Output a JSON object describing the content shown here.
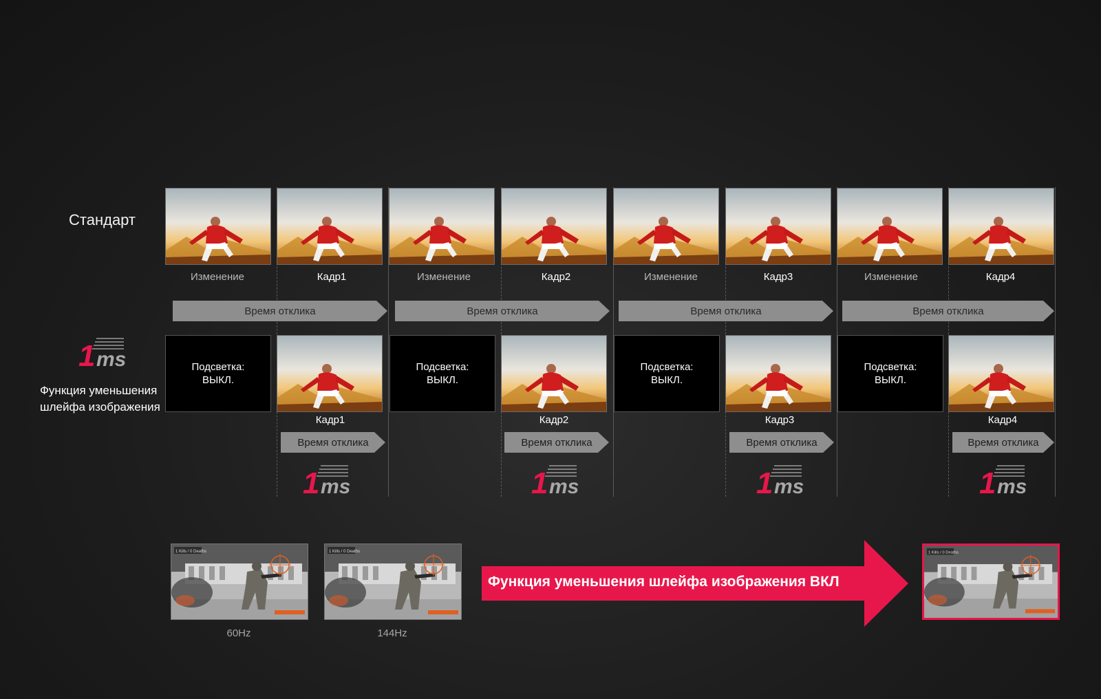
{
  "colors": {
    "accent": "#e8174b",
    "arrow_grey": "#8e8e8e"
  },
  "standard": {
    "label": "Стандарт",
    "captions": [
      "Изменение",
      "Кадр1",
      "Изменение",
      "Кадр2",
      "Изменение",
      "Кадр3",
      "Изменение",
      "Кадр4"
    ],
    "response_arrows": [
      "Время отклика",
      "Время отклика",
      "Время отклика",
      "Время отклика"
    ]
  },
  "mbr": {
    "logo_number": "1",
    "logo_unit": "ms",
    "label_line1": "Функция уменьшения",
    "label_line2": "шлейфа изображения",
    "backlight_line1": "Подсветка:",
    "backlight_line2": "ВЫКЛ.",
    "frames": [
      "Кадр1",
      "Кадр2",
      "Кадр3",
      "Кадр4"
    ],
    "response_arrows": [
      "Время отклика",
      "Время отклика",
      "Время отклика",
      "Время отклика"
    ]
  },
  "comparison": {
    "items": [
      {
        "label": "60Hz"
      },
      {
        "label": "144Hz"
      }
    ],
    "hud_text": "1 Kills / 0 Deaths",
    "banner": "Функция уменьшения шлейфа изображения ВКЛ"
  }
}
